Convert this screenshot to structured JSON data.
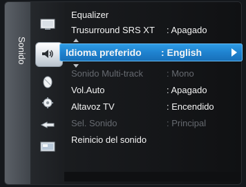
{
  "tab": {
    "label": "Sonido"
  },
  "icons": [
    "picture-icon",
    "sound-icon",
    "channel-icon",
    "setup-icon",
    "input-icon",
    "application-icon"
  ],
  "menu": {
    "items": [
      {
        "label": "Equalizer",
        "value": "",
        "dim": false
      },
      {
        "label": "Trusurround SRS XT",
        "value": ": Apagado",
        "dim": false
      },
      {
        "label": "Idioma preferido",
        "value": ": English",
        "dim": false,
        "selected": true
      },
      {
        "label": "Sonido Multi-track",
        "value": ": Mono",
        "dim": true
      },
      {
        "label": "Vol.Auto",
        "value": ": Apagado",
        "dim": false
      },
      {
        "label": "Altavoz TV",
        "value": ": Encendido",
        "dim": false
      },
      {
        "label": "Sel. Sonido",
        "value": ": Principal",
        "dim": true
      },
      {
        "label": "Reinicio del sonido",
        "value": "",
        "dim": false
      }
    ]
  },
  "colors": {
    "highlight": "#1f82cf",
    "text": "#f4f4f4",
    "dim": "#666a70"
  }
}
